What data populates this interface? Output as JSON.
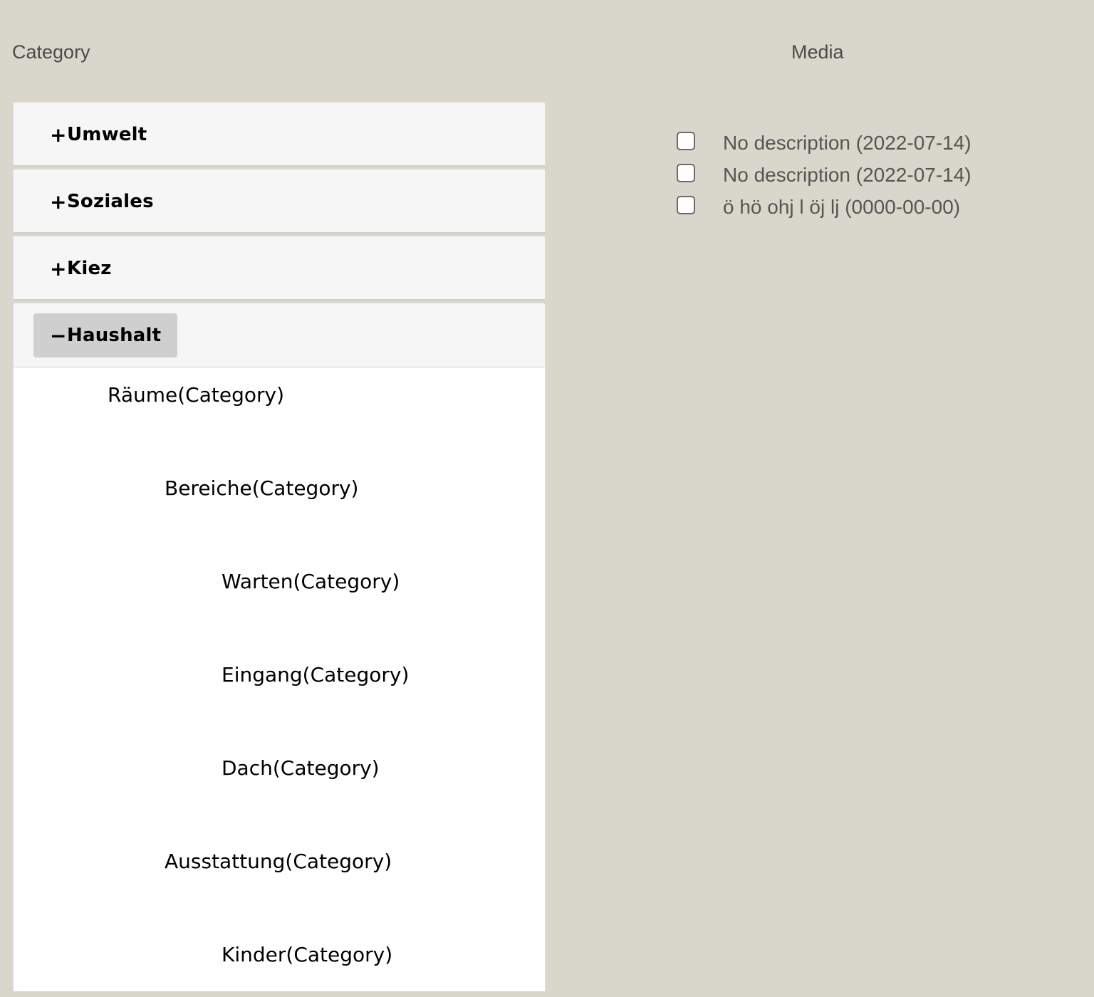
{
  "headings": {
    "category": "Category",
    "media": "Media"
  },
  "accordion": {
    "panels": [
      {
        "sign": "+",
        "label": "Umwelt"
      },
      {
        "sign": "+",
        "label": "Soziales"
      },
      {
        "sign": "+",
        "label": "Kiez"
      },
      {
        "sign": "−",
        "label": "Haushalt"
      }
    ]
  },
  "tree": {
    "items": [
      {
        "label": "Räume(Category)",
        "level": 1
      },
      {
        "label": "Bereiche(Category)",
        "level": 2
      },
      {
        "label": "Warten(Category)",
        "level": 3
      },
      {
        "label": "Eingang(Category)",
        "level": 3
      },
      {
        "label": "Dach(Category)",
        "level": 3
      },
      {
        "label": "Ausstattung(Category)",
        "level": 2
      },
      {
        "label": "Kinder(Category)",
        "level": 3
      }
    ]
  },
  "media": {
    "items": [
      {
        "label": "No description (2022-07-14)",
        "checked": false
      },
      {
        "label": "No description (2022-07-14)",
        "checked": false
      },
      {
        "label": "ö hö ohj l öj lj (0000-00-00)",
        "checked": false
      }
    ]
  },
  "colors": {
    "page_background": "#d9d7cb",
    "panel_background": "#f6f6f6",
    "active_toggle": "#cfcfcf",
    "tree_background": "#ffffff"
  }
}
